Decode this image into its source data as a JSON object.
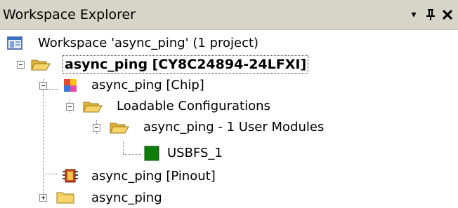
{
  "panel": {
    "title": "Workspace Explorer",
    "buttons": {
      "dropdown_glyph": "▾",
      "pin_glyph": "ᛞ",
      "close_glyph": "✕"
    }
  },
  "tree": {
    "items": [
      {
        "label": "Workspace 'async_ping' (1 project)",
        "icon": "workspace-icon"
      },
      {
        "label": "async_ping [CY8C24894-24LFXI]",
        "icon": "folder-open-icon",
        "expanded": true,
        "bold": true
      },
      {
        "label": "async_ping [Chip]",
        "icon": "chip-icon",
        "expanded": true
      },
      {
        "label": "Loadable Configurations",
        "icon": "folder-open-icon",
        "expanded": true
      },
      {
        "label": "async_ping - 1 User Modules",
        "icon": "folder-open-icon",
        "expanded": true
      },
      {
        "label": "USBFS_1",
        "icon": "user-module-icon"
      },
      {
        "label": "async_ping [Pinout]",
        "icon": "pinout-icon"
      },
      {
        "label": "async_ping",
        "icon": "folder-closed-icon",
        "expanded": false
      }
    ]
  },
  "colors": {
    "titlebar_bg": "#d7d4c8",
    "folder_yellow": "#f2c94c",
    "module_green": "#1f7a1f"
  }
}
